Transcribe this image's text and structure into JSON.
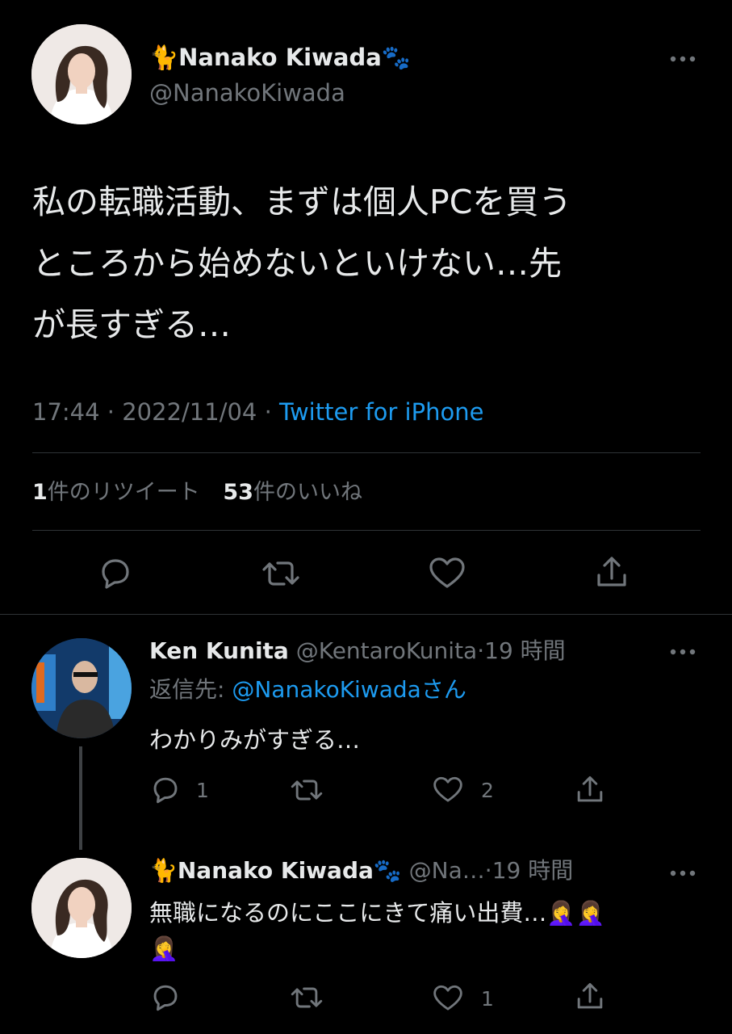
{
  "main_tweet": {
    "author": {
      "name_prefix_emoji": "🐈",
      "name": "Nanako Kiwada",
      "name_suffix_emoji": "🐾",
      "handle": "@NanakoKiwada"
    },
    "text_lines": [
      "私の転職活動、まずは個人PCを買う",
      "ところから始めないといけない…先",
      "が長すぎる…"
    ],
    "time": "17:44",
    "separator": "·",
    "date": "2022/11/04",
    "source": "Twitter for iPhone",
    "retweet_count": "1",
    "retweet_label": "件のリツイート",
    "like_count": "53",
    "like_label": "件のいいね"
  },
  "replies": [
    {
      "name": "Ken Kunita",
      "handle": "@KentaroKunita",
      "separator": "·",
      "time": "19 時間",
      "replying_to_label": "返信先:",
      "replying_to_handle": "@NanakoKiwada",
      "replying_to_suffix": "さん",
      "text": "わかりみがすぎる…",
      "reply_count": "1",
      "retweet_count": "",
      "like_count": "2"
    },
    {
      "name_prefix_emoji": "🐈",
      "name": "Nanako Kiwada",
      "name_suffix_emoji": "🐾",
      "handle": "@Na…",
      "separator": "·",
      "time": "19 時間",
      "text_line1": "無職になるのにここにきて痛い出費…🤦‍♀️🤦‍♀️",
      "text_line2": "🤦‍♀️",
      "reply_count": "",
      "retweet_count": "",
      "like_count": "1"
    }
  ],
  "icons": [
    "more-icon",
    "reply-icon",
    "retweet-icon",
    "like-icon",
    "share-icon"
  ],
  "colors": {
    "background": "#000000",
    "text": "#e7e9ea",
    "muted": "#71767b",
    "link": "#1d9bf0",
    "divider": "#2f3336"
  }
}
